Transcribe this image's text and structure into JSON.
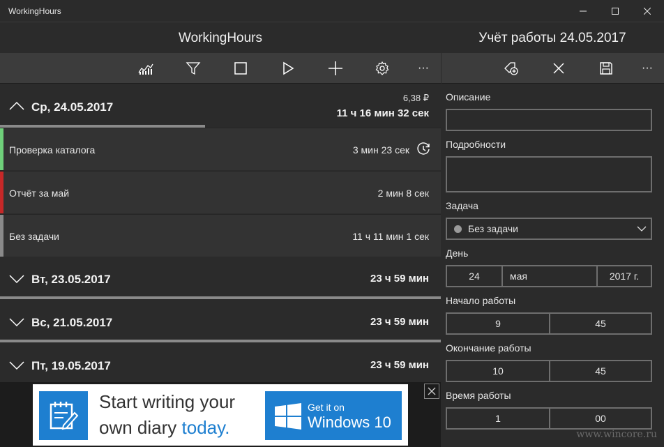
{
  "window": {
    "title": "WorkingHours"
  },
  "header": {
    "left_title": "WorkingHours",
    "right_title": "Учёт работы 24.05.2017"
  },
  "toolbar": {
    "left_buttons": [
      "chart-icon",
      "filter-icon",
      "stop-icon",
      "play-icon",
      "add-icon",
      "settings-icon",
      "more-icon"
    ],
    "right_buttons": [
      "new-task-icon",
      "close-icon",
      "save-icon",
      "more-icon"
    ],
    "more_label": "···"
  },
  "days": [
    {
      "label": "Ср, 24.05.2017",
      "cost": "6,38 ₽",
      "total": "11 ч 16 мин 32 сек",
      "expanded": true,
      "progress": 0.465,
      "tasks": [
        {
          "name": "Проверка каталога",
          "time": "3 мин 23 сек",
          "color": "#6fd07a",
          "running": true
        },
        {
          "name": "Отчёт за май",
          "time": "2 мин 8 сек",
          "color": "#c62828",
          "running": false
        },
        {
          "name": "Без задачи",
          "time": "11 ч 11 мин 1 сек",
          "color": "#8a8a8a",
          "running": false
        }
      ]
    },
    {
      "label": "Вт, 23.05.2017",
      "total": "23 ч 59 мин",
      "expanded": false
    },
    {
      "label": "Вс, 21.05.2017",
      "total": "23 ч 59 мин",
      "expanded": false
    },
    {
      "label": "Пт, 19.05.2017",
      "total": "23 ч 59 мин",
      "expanded": false
    }
  ],
  "ad": {
    "line1": "Start writing your",
    "line2_plain": "own diary",
    "line2_highlight": "today.",
    "badge_small": "Get it on",
    "badge_big": "Windows 10"
  },
  "form": {
    "description_label": "Описание",
    "description_value": "",
    "details_label": "Подробности",
    "details_value": "",
    "task_label": "Задача",
    "task_value": "Без задачи",
    "day_label": "День",
    "day": "24",
    "month": "мая",
    "year": "2017 г.",
    "start_label": "Начало работы",
    "start_hour": "9",
    "start_min": "45",
    "end_label": "Окончание работы",
    "end_hour": "10",
    "end_min": "45",
    "duration_label": "Время работы",
    "duration_hour": "1",
    "duration_min": "00"
  },
  "watermark": "www.wincore.ru",
  "colors": {
    "accent": "#1e7fd0",
    "background": "#2b2b2b",
    "toolbar": "#3c3c3c"
  }
}
